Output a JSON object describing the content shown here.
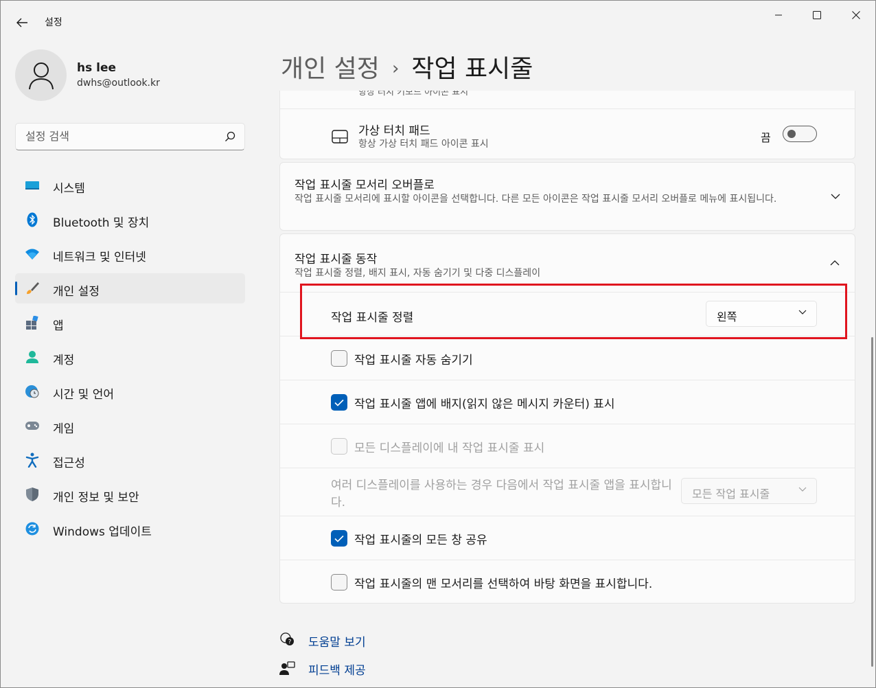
{
  "window": {
    "title": "설정"
  },
  "profile": {
    "name": "hs lee",
    "email": "dwhs@outlook.kr"
  },
  "search": {
    "placeholder": "설정 검색"
  },
  "sidebar": {
    "items": [
      {
        "label": "시스템",
        "icon": "system-icon"
      },
      {
        "label": "Bluetooth 및 장치",
        "icon": "bluetooth-icon"
      },
      {
        "label": "네트워크 및 인터넷",
        "icon": "wifi-icon"
      },
      {
        "label": "개인 설정",
        "icon": "paintbrush-icon",
        "selected": true
      },
      {
        "label": "앱",
        "icon": "apps-icon"
      },
      {
        "label": "계정",
        "icon": "account-icon"
      },
      {
        "label": "시간 및 언어",
        "icon": "time-language-icon"
      },
      {
        "label": "게임",
        "icon": "gamepad-icon"
      },
      {
        "label": "접근성",
        "icon": "accessibility-icon"
      },
      {
        "label": "개인 정보 및 보안",
        "icon": "shield-icon"
      },
      {
        "label": "Windows 업데이트",
        "icon": "update-icon"
      }
    ]
  },
  "header": {
    "parent": "개인 설정",
    "separator": "›",
    "current": "작업 표시줄"
  },
  "cut_off_text": "항상 터치 키보드 아이콘 표시",
  "touchpad": {
    "title": "가상 터치 패드",
    "subtitle": "항상 가상 터치 패드 아이콘 표시",
    "state_label": "끔",
    "toggle_on": false
  },
  "overflow": {
    "title": "작업 표시줄 모서리 오버플로",
    "subtitle": "작업 표시줄 모서리에 표시할 아이콘을 선택합니다. 다른 모든 아이콘은 작업 표시줄 모서리 오버플로 메뉴에 표시됩니다."
  },
  "behavior": {
    "title": "작업 표시줄 동작",
    "subtitle": "작업 표시줄 정렬, 배지 표시, 자동 숨기기 및 다중 디스플레이",
    "alignment": {
      "label": "작업 표시줄 정렬",
      "value": "왼쪽"
    },
    "auto_hide": {
      "label": "작업 표시줄 자동 숨기기",
      "checked": false
    },
    "badges": {
      "label": "작업 표시줄 앱에 배지(읽지 않은 메시지 카운터) 표시",
      "checked": true
    },
    "all_displays": {
      "label": "모든 디스플레이에 내 작업 표시줄 표시",
      "checked": false,
      "disabled": true
    },
    "multi_display": {
      "label": "여러 디스플레이를 사용하는 경우 다음에서 작업 표시줄 앱을 표시합니다.",
      "value": "모든 작업 표시줄"
    },
    "share_windows": {
      "label": "작업 표시줄의 모든 창 공유",
      "checked": true
    },
    "show_desktop": {
      "label": "작업 표시줄의 맨 모서리를 선택하여 바탕 화면을 표시합니다.",
      "checked": false
    }
  },
  "footer": {
    "help": "도움말 보기",
    "feedback": "피드백 제공"
  },
  "colors": {
    "accent": "#005fb8",
    "highlight": "#e0141e"
  }
}
